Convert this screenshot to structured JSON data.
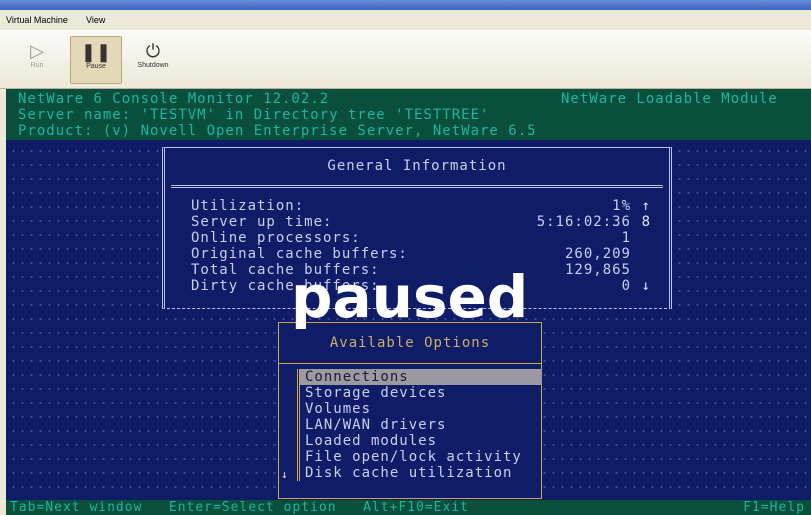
{
  "window": {
    "menu": [
      "Virtual Machine",
      "View"
    ]
  },
  "toolbar": {
    "run_label": "Run",
    "pause_label": "Pause",
    "shutdown_label": "Shutdown"
  },
  "console": {
    "header_lines": [
      "NetWare 6 Console Monitor 12.02.2",
      "Server name: 'TESTVM' in Directory tree 'TESTTREE'",
      "Product: (v) Novell Open Enterprise Server, NetWare 6.5"
    ],
    "header_right": "NetWare Loadable Module",
    "general": {
      "title": "General Information",
      "rows": [
        {
          "label": "Utilization:",
          "value": "1%",
          "marker": "↑"
        },
        {
          "label": "Server up time:",
          "value": "5:16:02:36",
          "marker": "8"
        },
        {
          "label": "Online processors:",
          "value": "1",
          "marker": ""
        },
        {
          "label": "Original cache buffers:",
          "value": "260,209",
          "marker": ""
        },
        {
          "label": "Total cache buffers:",
          "value": "129,865",
          "marker": ""
        },
        {
          "label": "Dirty cache buffers:",
          "value": "0",
          "marker": "↓"
        }
      ]
    },
    "options": {
      "title": "Available Options",
      "items": [
        "Connections",
        "Storage devices",
        "Volumes",
        "LAN/WAN drivers",
        "Loaded modules",
        "File open/lock activity",
        "Disk cache utilization"
      ],
      "selected_index": 0,
      "scroll_marker": "↓"
    },
    "overlay": "paused",
    "status": {
      "left": "Tab=Next window   Enter=Select option   Alt+F10=Exit",
      "right": "F1=Help"
    }
  }
}
